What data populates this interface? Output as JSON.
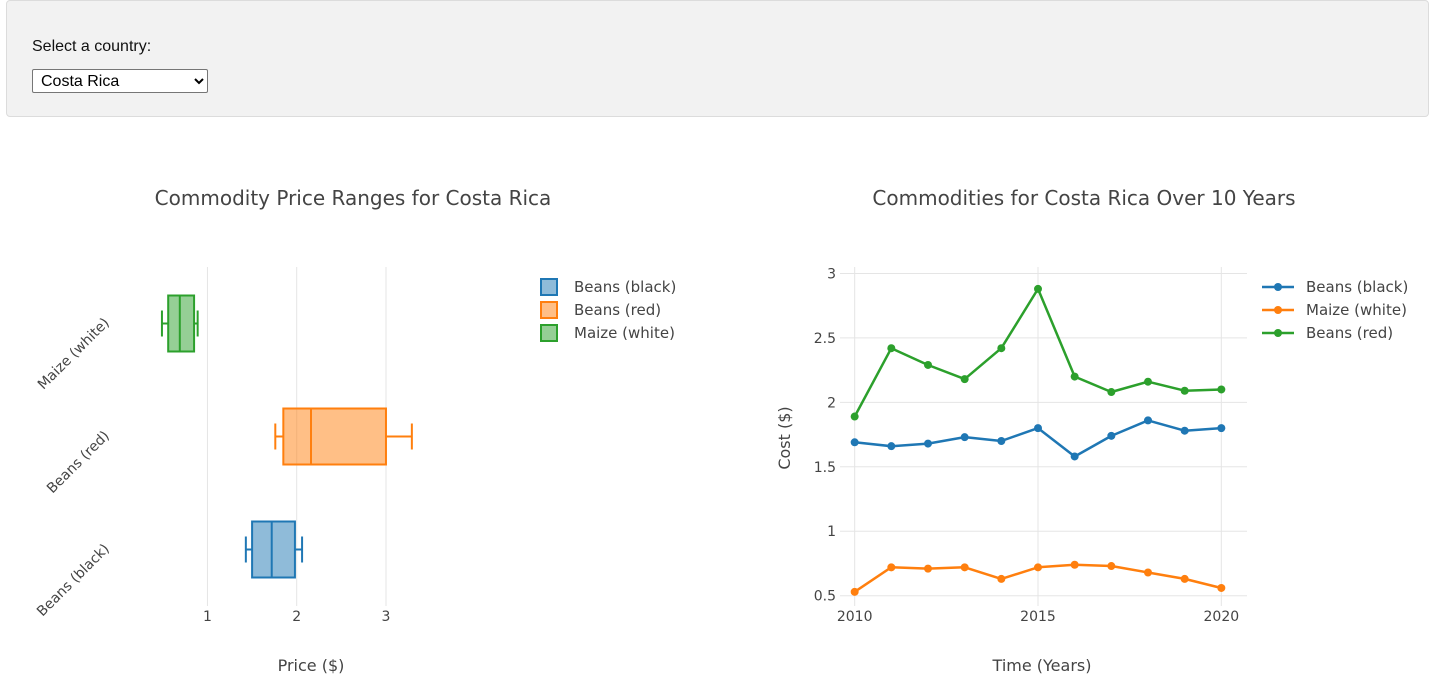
{
  "selector": {
    "label": "Select a country:",
    "selected": "Costa Rica"
  },
  "chart_data": [
    {
      "type": "box",
      "title": "Commodity Price Ranges for Costa Rica",
      "xlabel": "Price ($)",
      "ylabel": "",
      "xlim": [
        0.02,
        4.3
      ],
      "xticks": [
        1,
        2,
        3
      ],
      "categories": [
        "Beans (black)",
        "Beans (red)",
        "Maize (white)"
      ],
      "legend": {
        "position": "top-right",
        "entries": [
          "Beans (black)",
          "Beans (red)",
          "Maize (white)"
        ]
      },
      "grid": true,
      "series": [
        {
          "name": "Beans (black)",
          "color": "#1f77b4",
          "fill": "rgba(31,119,180,0.5)",
          "min": 1.43,
          "q1": 1.5,
          "median": 1.72,
          "q3": 1.98,
          "max": 2.06
        },
        {
          "name": "Beans (red)",
          "color": "#ff7f0e",
          "fill": "rgba(255,127,14,0.5)",
          "min": 1.76,
          "q1": 1.85,
          "median": 2.16,
          "q3": 3.0,
          "max": 3.29
        },
        {
          "name": "Maize (white)",
          "color": "#2ca02c",
          "fill": "rgba(44,160,44,0.5)",
          "min": 0.49,
          "q1": 0.56,
          "median": 0.69,
          "q3": 0.85,
          "max": 0.89
        }
      ]
    },
    {
      "type": "line",
      "title": "Commodities for Costa Rica Over 10 Years",
      "xlabel": "Time (Years)",
      "ylabel": "Cost ($)",
      "xlim": [
        2009.6,
        2020.7
      ],
      "ylim": [
        0.42,
        3.05
      ],
      "xticks": [
        2010,
        2015,
        2020
      ],
      "yticks": [
        0.5,
        1,
        1.5,
        2,
        2.5,
        3
      ],
      "legend": {
        "position": "top-right"
      },
      "grid": true,
      "x": [
        2010,
        2011,
        2012,
        2013,
        2014,
        2015,
        2016,
        2017,
        2018,
        2019,
        2020
      ],
      "series": [
        {
          "name": "Beans (black)",
          "color": "#1f77b4",
          "values": [
            1.69,
            1.66,
            1.68,
            1.73,
            1.7,
            1.8,
            1.58,
            1.74,
            1.86,
            1.78,
            1.8
          ]
        },
        {
          "name": "Maize (white)",
          "color": "#ff7f0e",
          "values": [
            0.53,
            0.72,
            0.71,
            0.72,
            0.63,
            0.72,
            0.74,
            0.73,
            0.68,
            0.63,
            0.56
          ]
        },
        {
          "name": "Beans (red)",
          "color": "#2ca02c",
          "values": [
            1.89,
            2.42,
            2.29,
            2.18,
            2.42,
            2.88,
            2.2,
            2.08,
            2.16,
            2.09,
            2.1
          ]
        }
      ]
    }
  ]
}
